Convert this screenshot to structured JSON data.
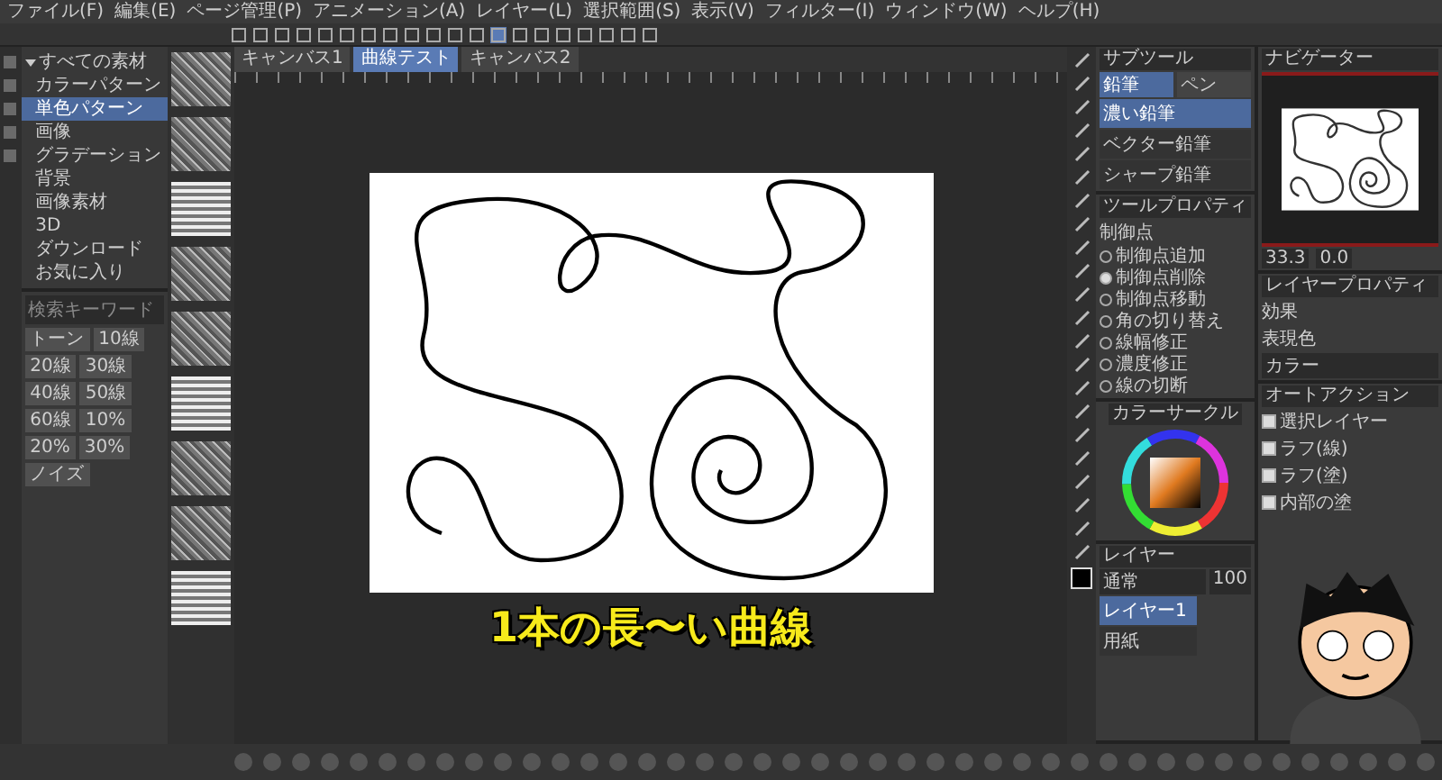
{
  "menu": [
    {
      "label": "ファイル(F)"
    },
    {
      "label": "編集(E)"
    },
    {
      "label": "ページ管理(P)"
    },
    {
      "label": "アニメーション(A)"
    },
    {
      "label": "レイヤー(L)"
    },
    {
      "label": "選択範囲(S)"
    },
    {
      "label": "表示(V)"
    },
    {
      "label": "フィルター(I)"
    },
    {
      "label": "ウィンドウ(W)"
    },
    {
      "label": "ヘルプ(H)"
    }
  ],
  "document_tabs": [
    {
      "label": "キャンバス1",
      "selected": false
    },
    {
      "label": "曲線テスト",
      "selected": true
    },
    {
      "label": "キャンバス2",
      "selected": false
    }
  ],
  "material_panel": {
    "tree": [
      {
        "label": "すべての素材",
        "expanded": true,
        "selected": false,
        "children": [
          {
            "label": "カラーパターン",
            "selected": false
          },
          {
            "label": "単色パターン",
            "selected": true
          },
          {
            "label": "画像",
            "selected": false
          },
          {
            "label": "グラデーション",
            "selected": false
          },
          {
            "label": "背景",
            "selected": false
          },
          {
            "label": "画像素材",
            "selected": false
          },
          {
            "label": "3D",
            "selected": false
          },
          {
            "label": "ダウンロード",
            "selected": false
          },
          {
            "label": "お気に入り",
            "selected": false
          }
        ]
      }
    ]
  },
  "tag_panel": {
    "search_placeholder": "検索キーワード",
    "tags": [
      {
        "label": "トーン",
        "selected": false
      },
      {
        "label": "10線",
        "selected": false
      },
      {
        "label": "20線",
        "selected": false
      },
      {
        "label": "30線",
        "selected": false
      },
      {
        "label": "40線",
        "selected": false
      },
      {
        "label": "50線",
        "selected": false
      },
      {
        "label": "60線",
        "selected": false
      },
      {
        "label": "10%",
        "selected": false
      },
      {
        "label": "20%",
        "selected": false
      },
      {
        "label": "30%",
        "selected": false
      },
      {
        "label": "ノイズ",
        "selected": false
      }
    ]
  },
  "caption": "1本の長〜い曲線",
  "sub_tool": {
    "title": "サブツール",
    "tabs": [
      {
        "label": "鉛筆",
        "selected": true
      },
      {
        "label": "ペン",
        "selected": false
      }
    ],
    "items": [
      {
        "label": "濃い鉛筆",
        "selected": true
      },
      {
        "label": "ベクター鉛筆",
        "selected": false
      },
      {
        "label": "シャープ鉛筆",
        "selected": false
      }
    ]
  },
  "tool_property": {
    "title": "ツールプロパティ",
    "heading": "制御点",
    "options": [
      {
        "label": "制御点追加",
        "selected": false
      },
      {
        "label": "制御点削除",
        "selected": true
      },
      {
        "label": "制御点移動",
        "selected": false
      },
      {
        "label": "角の切り替え",
        "selected": false
      },
      {
        "label": "線幅修正",
        "selected": false
      },
      {
        "label": "濃度修正",
        "selected": false
      },
      {
        "label": "線の切断",
        "selected": false
      }
    ]
  },
  "navigator": {
    "title": "ナビゲーター",
    "zoom": "33.3",
    "angle": "0.0"
  },
  "color_circle": {
    "title": "カラーサークル"
  },
  "layer_property": {
    "title": "レイヤープロパティ",
    "effect_label": "効果",
    "color_label": "表現色",
    "color_value": "カラー"
  },
  "layers": {
    "title": "レイヤー",
    "blend_mode": "通常",
    "opacity": "100",
    "rows": [
      {
        "name": "レイヤー1",
        "selected": true
      },
      {
        "name": "用紙",
        "selected": false
      }
    ]
  },
  "auto_action": {
    "title": "オートアクション",
    "rows": [
      {
        "label": "選択レイヤー",
        "checked": true
      },
      {
        "label": "ラフ(線)",
        "checked": true
      },
      {
        "label": "ラフ(塗)",
        "checked": true
      },
      {
        "label": "内部の塗",
        "checked": true
      }
    ]
  }
}
